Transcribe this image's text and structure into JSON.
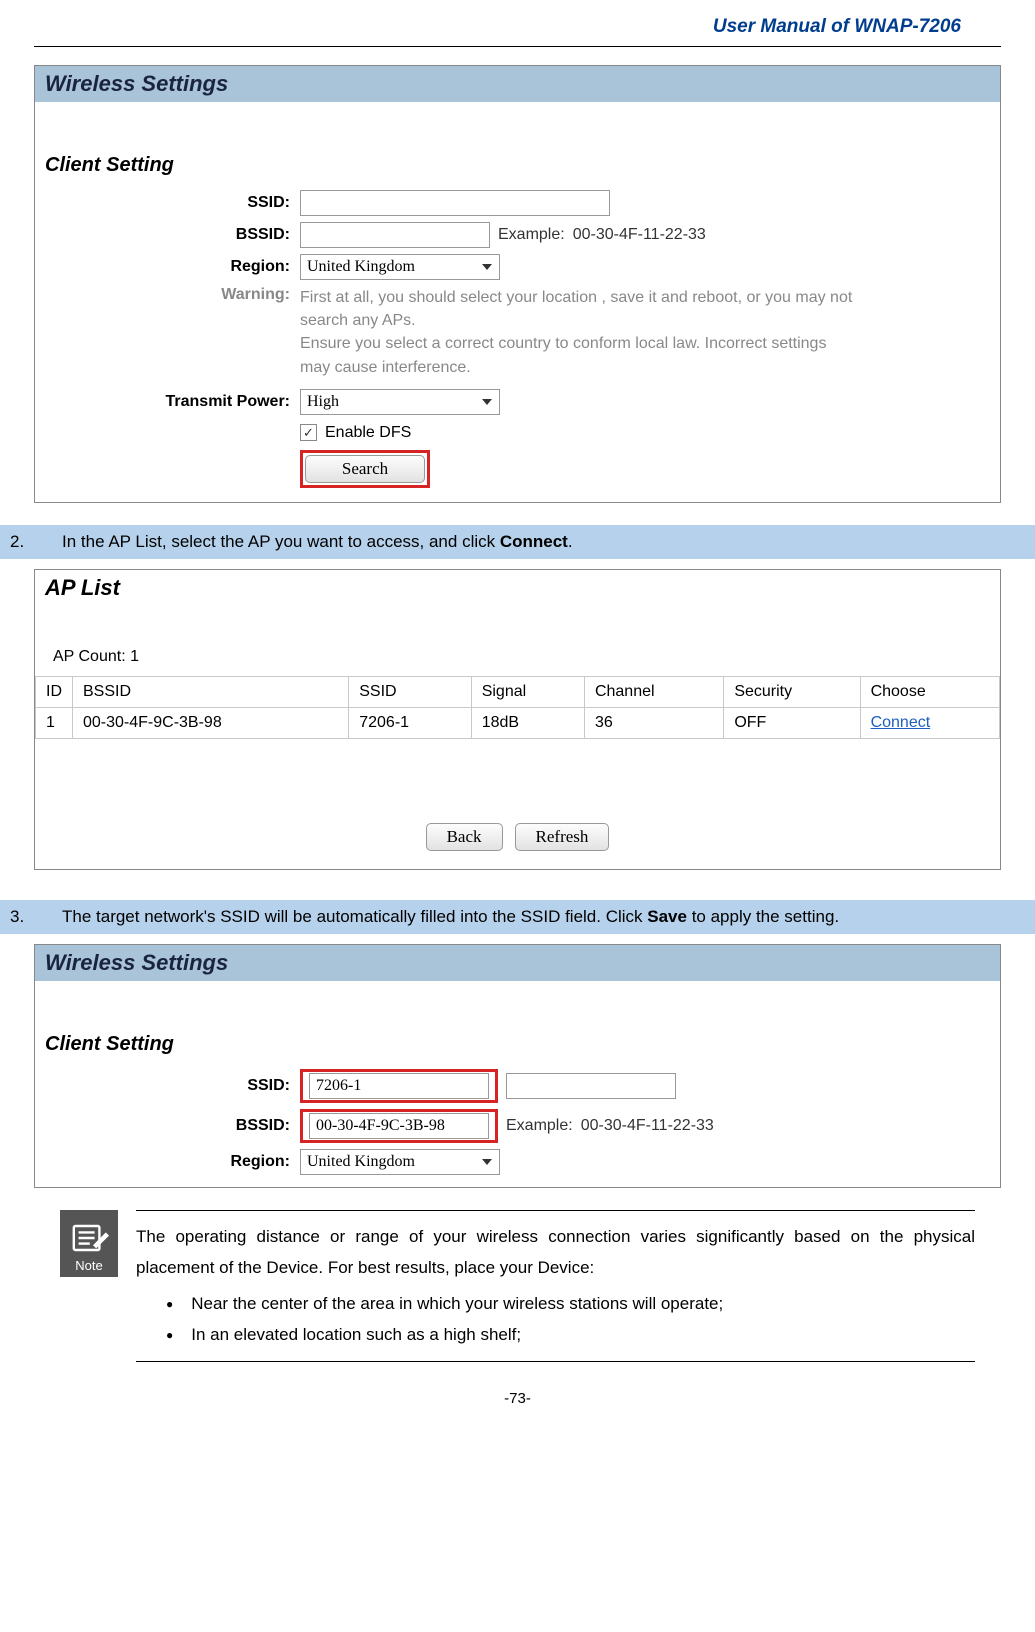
{
  "page": {
    "header": "User Manual of WNAP-7206",
    "footer": "-73-"
  },
  "panel1": {
    "title": "Wireless Settings",
    "section": "Client Setting",
    "labels": {
      "ssid": "SSID:",
      "bssid": "BSSID:",
      "region": "Region:",
      "warning": "Warning:",
      "transmit": "Transmit Power:"
    },
    "bssid_example_label": "Example:",
    "bssid_example_value": "00-30-4F-11-22-33",
    "region_value": "United Kingdom",
    "warning_text": "First at all, you should select your location , save it and reboot, or you may not search any APs.\nEnsure you select a correct country to conform local law. Incorrect settings may cause interference.",
    "transmit_value": "High",
    "dfs_label": "Enable DFS",
    "dfs_checked": "✓",
    "search_btn": "Search"
  },
  "step2": {
    "num": "2.",
    "text_prefix": "In the AP List, select the AP you want to access, and click ",
    "text_bold": "Connect",
    "text_suffix": "."
  },
  "panel2": {
    "title": "AP List",
    "count_label": "AP Count:   1",
    "headers": {
      "id": "ID",
      "bssid": "BSSID",
      "ssid": "SSID",
      "signal": "Signal",
      "channel": "Channel",
      "security": "Security",
      "choose": "Choose"
    },
    "row": {
      "id": "1",
      "bssid": "00-30-4F-9C-3B-98",
      "ssid": "7206-1",
      "signal": "18dB",
      "channel": "36",
      "security": "OFF",
      "choose": "Connect"
    },
    "back_btn": "Back",
    "refresh_btn": "Refresh"
  },
  "step3": {
    "num": "3.",
    "text_prefix": "The target network's SSID will be automatically filled into the SSID field. Click ",
    "text_bold": "Save",
    "text_suffix": " to apply the setting."
  },
  "panel3": {
    "title": "Wireless Settings",
    "section": "Client Setting",
    "labels": {
      "ssid": "SSID:",
      "bssid": "BSSID:",
      "region": "Region:"
    },
    "ssid_value": "7206-1",
    "bssid_value": "00-30-4F-9C-3B-98",
    "bssid_example_label": "Example:",
    "bssid_example_value": "00-30-4F-11-22-33",
    "region_value": "United Kingdom"
  },
  "note": {
    "icon_label": "Note",
    "intro": "The operating distance or range of your wireless connection varies significantly based on the physical placement of the Device. For best results, place your Device:",
    "bullets": [
      "Near the center of the area in which your wireless stations will operate;",
      "In an elevated location such as a high shelf;"
    ]
  }
}
